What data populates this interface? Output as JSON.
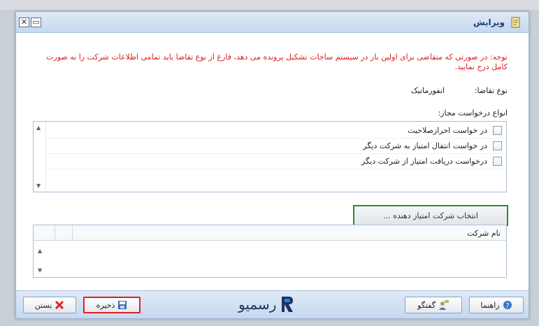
{
  "window": {
    "title": "ویرایش"
  },
  "notice": "توجه: در صورتی که متقاضی برای اولین بار در سیستم ساجات تشکیل پرونده می دهد، فارغ از نوع تقاضا باید تمامی اطلاعات شرکت را به صورت کامل درج نمایید.",
  "request_type": {
    "label": "نوع تقاضا:",
    "value": "انفورماتیک"
  },
  "allowed_requests": {
    "label": "انواع درخواست مجاز:",
    "items": [
      {
        "label": "در خواست احرازصلاحیت",
        "checked": false
      },
      {
        "label": "در خواست انتقال امتیاز به شرکت دیگر",
        "checked": false
      },
      {
        "label": "درخواست دریافت امتیاز از شرکت دیگر",
        "checked": false
      }
    ]
  },
  "select_company_button": "انتخاب شرکت امتیاز دهنده ...",
  "grid": {
    "columns": [
      "نام شرکت"
    ]
  },
  "footer": {
    "close_label": "بستن",
    "save_label": "ذخیره",
    "chat_label": "گفتگو",
    "help_label": "راهنما",
    "brand": "رسمیو"
  },
  "colors": {
    "notice": "#d81e1e",
    "highlight_green": "#2e8b23",
    "highlight_red": "#e02020",
    "brand_blue": "#1a3561"
  }
}
